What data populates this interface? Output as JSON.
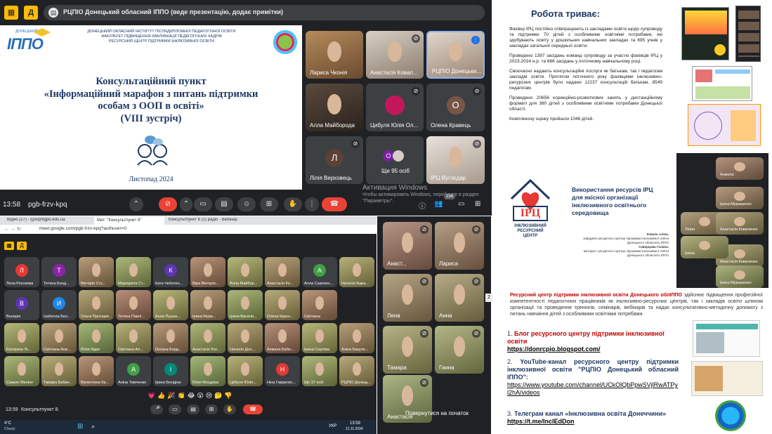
{
  "top_meet": {
    "presenter_title": "РЦПІО Донецький обласний ІППО (веде презентацію, додає примітки)",
    "slide": {
      "institute_lines": [
        "ДОНЕЦЬКИЙ ОБЛАСНИЙ ІНСТИТУТ ПІСЛЯДИПЛОМНОЇ ПЕДАГОГІЧНОЇ ОСВІТИ",
        "ФАКУЛЬТЕТ ПІДВИЩЕННЯ КВАЛІФІКАЦІЇ ПЕДАГОГІЧНИХ КАДРІВ",
        "РЕСУРСНИЙ ЦЕНТР ПІДТРИМКИ ІНКЛЮЗИВНОЇ ОСВІТИ"
      ],
      "logo_text": "ІППО",
      "logo_small": "ДОНЕЦЬКИЙ",
      "title_lines": [
        "Консультаційний пункт",
        "«Інформаційний марафон з питань підтримки",
        "особам з ООП в освіті»",
        "(VIII зустріч)"
      ],
      "date": "Листопад 2024"
    },
    "participants": [
      {
        "name": "Лариса Чконія",
        "type": "video"
      },
      {
        "name": "Анастасія Ковал...",
        "type": "video"
      },
      {
        "name": "РЦПІО Донецьки...",
        "type": "video"
      },
      {
        "name": "Алла Майборода",
        "type": "video"
      },
      {
        "name": "Цибуля Юлія Ол...",
        "type": "avatar"
      },
      {
        "name": "Олена Кравець",
        "type": "letter",
        "letter": "О"
      },
      {
        "name": "Лілія Верховець",
        "type": "letter",
        "letter": "Л"
      },
      {
        "name": "Ще 95 осіб",
        "type": "more"
      },
      {
        "name": "ІРЦ Вуглєдар",
        "type": "video"
      }
    ],
    "activation": {
      "title": "Активация Windows",
      "body": "Чтобы активировать Windows, перейдите в раздел \"Параметры\"."
    },
    "badge_count": "104"
  },
  "bottom_meet": {
    "tabs": [
      "Відео (27) - rjpo@dgpo.edu.ua",
      "Мет: \"Консультпункт 8\"",
      "Консультпункт 8 (1) радіо - Вебінар"
    ],
    "url": "meet.google.com/pgb-frzv-kpq?authuser=0",
    "meeting_code": "pgb-frzv-kpq",
    "participants": [
      "Лена Россиева",
      "Тетяна Бонд...",
      "Вікторія Сту...",
      "Маргарита Ст...",
      "Ката Чеботен...",
      "Віра Вікторія...",
      "Алла Майбор...",
      "Анастасія Ко...",
      "Алла Сазонен...",
      "Наталія Бара...",
      "Валерія",
      "Ізабелла Бел...",
      "Ольга Просіцев...",
      "Тетяна Павлі...",
      "Анна Пушка...",
      "Ірина Мура...",
      "Ірина Васили...",
      "Олена Красн...",
      "Світлана",
      "Катерина Лі...",
      "Світлана Ани...",
      "Юлія Ядик",
      "Світлана Ап...",
      "Оксана Борд...",
      "Анастасія Кос...",
      "Наталія Дол...",
      "Анжела Бабе...",
      "Ірина Сергіїва",
      "Аліна Бакуле...",
      "Саакян Меліне",
      "Тамара Бабин...",
      "Валентина Кр...",
      "Аліна Тимченко",
      "Ірина Бесідіна",
      "Юлія Моєдова",
      "Цибуля Юлія...",
      "Ніна Гавриляс...",
      "Ще 37 осіб",
      "РЦПІО Донець..."
    ],
    "letters": {
      "Лена Россиева": "Л",
      "Тетяна Бонд...": "Т",
      "Ката Чеботен...": "К",
      "Валерія": "В",
      "Ізабелла Бел...": "И",
      "Аліна Тимченко": "А",
      "Ірина Бесідіна": "І",
      "Ніна Гавриляс...": "Н",
      "Алла Сазонен...": "А"
    },
    "time": "13:59",
    "meeting_name": "Консультпункт 8.",
    "taskbar": {
      "temp": "4°C",
      "weather": "Cloudy",
      "clock": "13:59",
      "date": "21.11.2024",
      "lang": "УКР"
    }
  },
  "right_phone_meet": {
    "participants": [
      "Анаст...",
      "Лариса",
      "Лена",
      "Анна",
      "Тамара",
      "Ганна",
      "Анастасія"
    ],
    "return_label": "Повернутися на початок"
  },
  "slide_progress": {
    "heading": "Робота триває:",
    "paragraphs": [
      "Фахівці ІРЦ постійно співпрацюють із закладами освіти щодо супроводу та підтримки 70 дітей з особливими освітніми потребами, які здобувають освіту у дошкільних навчальних закладах та 695 учнів у закладах загальної середньої освіти.",
      "Проведено 1397 засідань команд супроводу за участю фахівців ІРЦ у 2023-2024 н.р. та 686 засідань у поточному навчальному році.",
      "Своєчасно надають консультаційні послуги як батькам, так і педагогам закладів освіти. Протягом поточного року фахівцями інклюзивно-ресурсних центрів було надано 12237 консультацій батькам, 8549 педагогам.",
      "Проведено 20656 корекційно-розвиткових занять у дистанційному форматі для 380 дітей з особливими освітніми потребами Донецької області.",
      "Комплексну оцінку пройшли 1046 дітей."
    ]
  },
  "slide_irc": {
    "logo_letters": "ІРЦ",
    "logo_caption": [
      "ІНКЛЮЗИВНИЙ",
      "РЕСУРСНИЙ",
      "ЦЕНТР"
    ],
    "title": "Використання ресурсів ІРЦ для якісної організації інклюзивного освітнього середовища",
    "authors": [
      "Коваль Аліна,",
      "завідувач ресурсного центру підтримки інклюзивної освіти",
      "Донецького обласного ІППО",
      "Скворцова Галина,",
      "методист ресурсного центру підтримки інклюзивної освіти",
      "Донецького обласного ІППО"
    ]
  },
  "side_participants": [
    {
      "name": "Анжела"
    },
    {
      "name": "Ірина Мурашенко"
    },
    {
      "name": "Лілия"
    },
    {
      "name": "Анастасія Коваленко"
    },
    {
      "name": "Анастасія Коваленко"
    },
    {
      "name": "Ірина"
    },
    {
      "name": "Ірина Мурашенко"
    }
  ],
  "slide_links": {
    "intro_highlight": "Ресурсний центр підтримки інклюзивної освіти Донецького облІППО",
    "intro_rest": " здійснює підвищення професійної компетентності педагогічних працівників як інклюзивно-ресурсних центрів, так і закладів освіти шляхом організації та проведення тренінгів, семінарів, вебінарів та надає консультативно-методичну допомогу з питань навчання дітей з особливими освітніми потребами.",
    "items": [
      {
        "num": "1.",
        "label": "Блог ресурсного центру підтримки інклюзивної освіти",
        "link": "https://donrcpio.blogspot.com/"
      },
      {
        "num": "2.",
        "label": "YouTube-канал ресурсного центру підтримки інклюзивної освіти \"РЦПІО Донецький обласний ІППО\":",
        "link": "https://www.youtube.com/channel/UCkOlQbPpwSVjlRwATPyl2hA/videos"
      },
      {
        "num": "3.",
        "label": "Телеграм канал «Інклюзивна освіта Донеччини»",
        "link": "https://t.me/InclEdDon"
      }
    ],
    "page_num": "2"
  },
  "colors": {
    "meet_bg": "#202124",
    "tile": "#3c4043",
    "hangup": "#ea4335",
    "heading_blue": "#1f3864",
    "red_text": "#c00000"
  }
}
